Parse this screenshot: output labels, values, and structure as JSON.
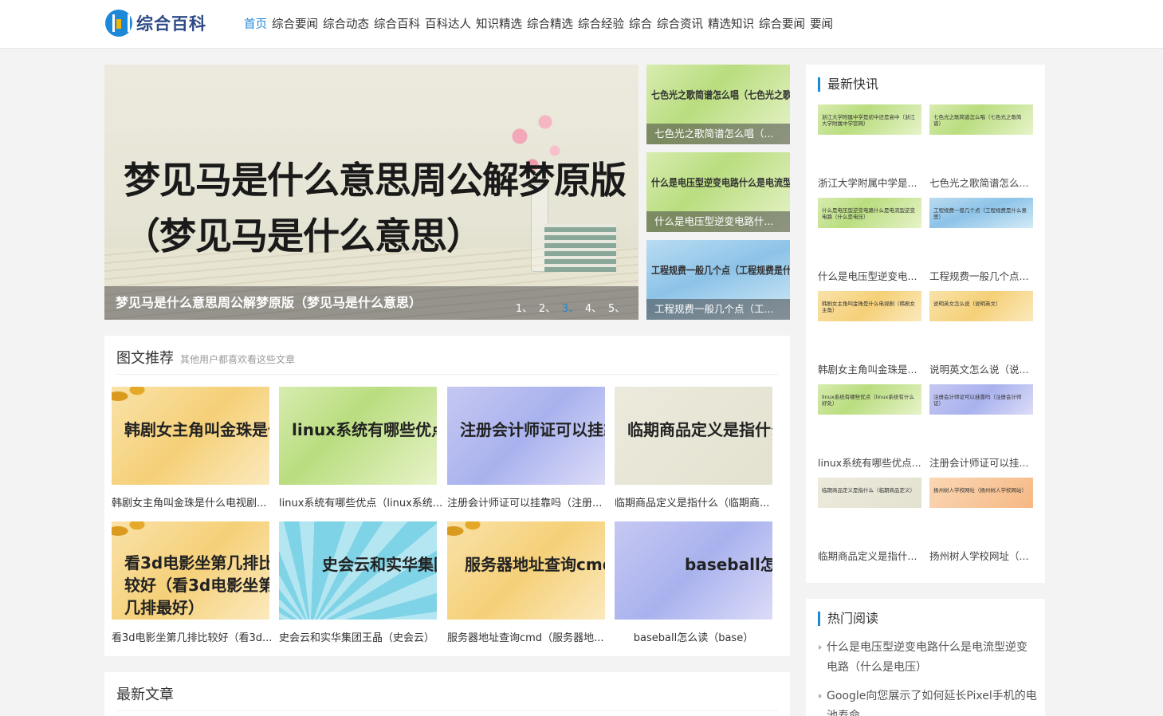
{
  "header": {
    "logo_text": "综合百科",
    "nav": [
      "首页",
      "综合要闻",
      "综合动态",
      "综合百科",
      "百科达人",
      "知识精选",
      "综合精选",
      "综合经验",
      "综合",
      "综合资讯",
      "精选知识",
      "综合要闻",
      "要闻"
    ]
  },
  "slider": {
    "big_text": "梦见马是什么意思周公解梦原版（梦见马是什么意思）",
    "caption": "梦见马是什么意思周公解梦原版（梦见马是什么意思）",
    "dots": [
      "1、",
      "2、",
      "3、",
      "4、",
      "5、"
    ],
    "active_dot": 3
  },
  "side_thumbs": [
    {
      "text": "七色光之歌简谱怎么唱（七色光之歌简谱）",
      "caption": "七色光之歌简谱怎么唱（..."
    },
    {
      "text": "什么是电压型逆变电路什么是电流型逆变电路（什么是电压）",
      "caption": "什么是电压型逆变电路什..."
    },
    {
      "text": "工程规费一般几个点（工程规费是什么意思）",
      "caption": "工程规费一般几个点（工..."
    }
  ],
  "recommend": {
    "title": "图文推荐",
    "subtitle": "其他用户都喜欢看这些文章",
    "items": [
      {
        "img_text": "韩剧女主角叫金珠是什么电视剧（",
        "caption": "韩剧女主角叫金珠是什么电视剧..."
      },
      {
        "img_text": "linux系统有哪些优点（",
        "caption": "linux系统有哪些优点（linux系统..."
      },
      {
        "img_text": "注册会计师证可以挂靠吗",
        "caption": "注册会计师证可以挂靠吗（注册..."
      },
      {
        "img_text": "临期商品定义是指什么",
        "caption": "临期商品定义是指什么（临期商..."
      },
      {
        "img_text": "看3d电影坐第几排比较好（看3d电影坐第几排最好）",
        "caption": "看3d电影坐第几排比较好（看3d..."
      },
      {
        "img_text": "史会云和实华集团王晶",
        "caption": "史会云和实华集团王晶（史会云）"
      },
      {
        "img_text": "服务器地址查询cmd",
        "caption": "服务器地址查询cmd（服务器地..."
      },
      {
        "img_text": "baseball怎么读",
        "caption": "baseball怎么读（base）"
      }
    ]
  },
  "latest": {
    "title": "最新文章"
  },
  "kuaixun": {
    "title": "最新快讯",
    "items": [
      {
        "img_text": "浙江大学附属中学是初中还是高中（浙江大学附属中学官网）",
        "caption": "浙江大学附属中学是..."
      },
      {
        "img_text": "七色光之歌简谱怎么唱（七色光之歌简谱）",
        "caption": "七色光之歌简谱怎么..."
      },
      {
        "img_text": "什么是电压型逆变电路什么是电流型逆变电路（什么是电压）",
        "caption": "什么是电压型逆变电..."
      },
      {
        "img_text": "工程规费一般几个点（工程规费是什么意思）",
        "caption": "工程规费一般几个点..."
      },
      {
        "img_text": "韩剧女主角叫金珠是什么电视剧（韩剧女主角）",
        "caption": "韩剧女主角叫金珠是..."
      },
      {
        "img_text": "说明英文怎么说（说明英文）",
        "caption": "说明英文怎么说（说..."
      },
      {
        "img_text": "linux系统有哪些优点（linux系统有什么好处）",
        "caption": "linux系统有哪些优点..."
      },
      {
        "img_text": "注册会计师证可以挂靠吗（注册会计师证）",
        "caption": "注册会计师证可以挂..."
      },
      {
        "img_text": "临期商品定义是指什么（临期商品定义）",
        "caption": "临期商品定义是指什..."
      },
      {
        "img_text": "扬州树人学校网址（扬州树人学校网站）",
        "caption": "扬州树人学校网址（..."
      }
    ]
  },
  "hot": {
    "title": "热门阅读",
    "items": [
      "什么是电压型逆变电路什么是电流型逆变电路（什么是电压）",
      "Google向您展示了如何延长Pixel手机的电池寿命"
    ]
  }
}
